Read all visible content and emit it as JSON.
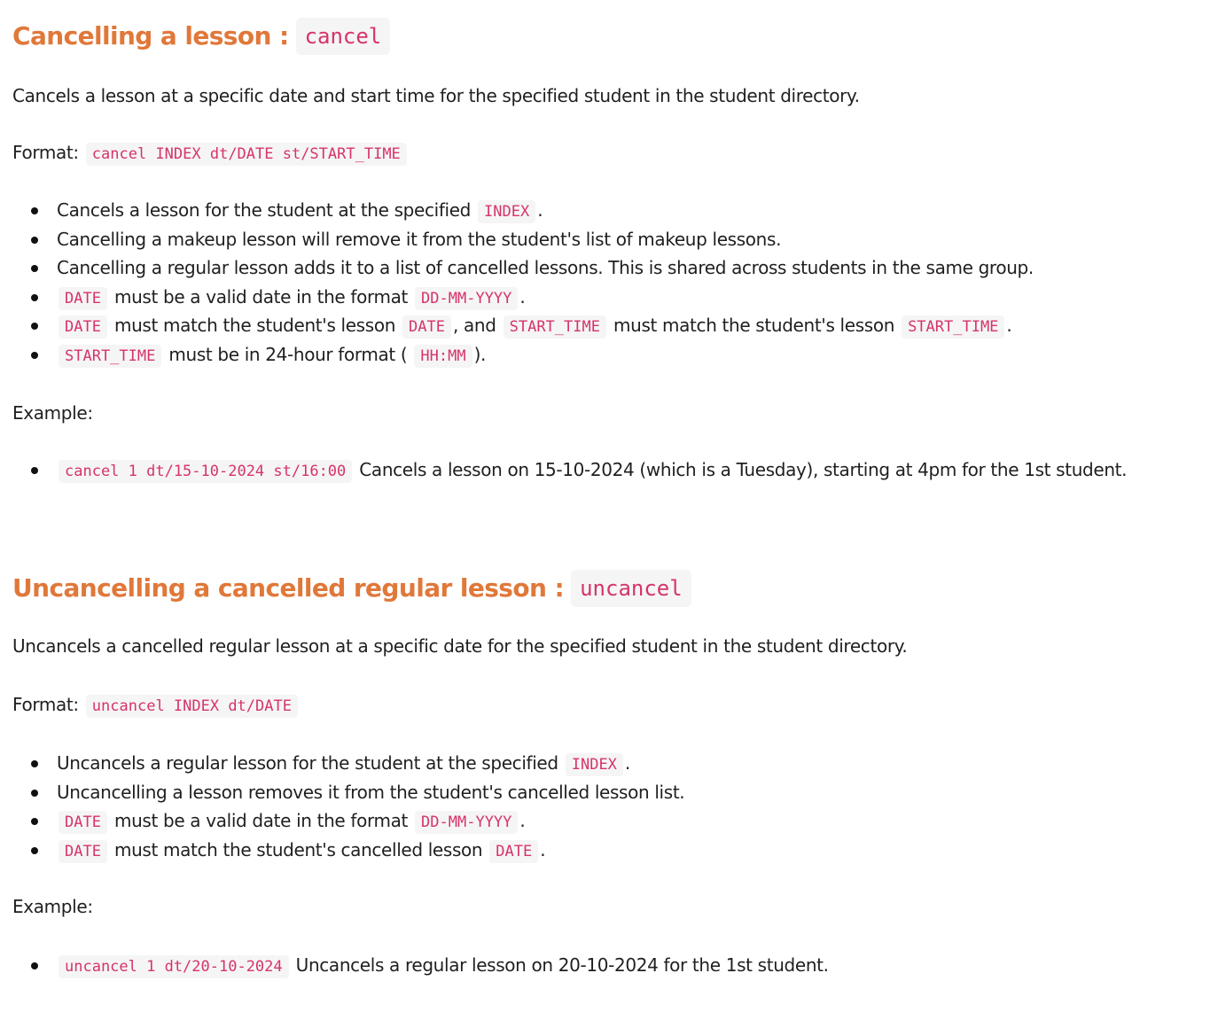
{
  "sections": [
    {
      "title": "Cancelling a lesson :",
      "command": "cancel",
      "description": "Cancels a lesson at a specific date and start time for the specified student in the student directory.",
      "format_label": "Format:",
      "format_code": "cancel INDEX dt/DATE st/START_TIME",
      "bullets": {
        "b1": {
          "t1": "Cancels a lesson for the student at the specified",
          "c1": "INDEX",
          "t2": "."
        },
        "b2": {
          "t1": "Cancelling a makeup lesson will remove it from the student's list of makeup lessons."
        },
        "b3": {
          "t1": "Cancelling a regular lesson adds it to a list of cancelled lessons. This is shared across students in the same group."
        },
        "b4": {
          "c1": "DATE",
          "t1": "must be a valid date in the format",
          "c2": "DD-MM-YYYY",
          "t2": "."
        },
        "b5": {
          "c1": "DATE",
          "t1": "must match the student's lesson",
          "c2": "DATE",
          "t2": ", and",
          "c3": "START_TIME",
          "t3": "must match the student's lesson",
          "c4": "START_TIME",
          "t4": "."
        },
        "b6": {
          "c1": "START_TIME",
          "t1": "must be in 24-hour format (",
          "c2": "HH:MM",
          "t2": ")."
        }
      },
      "example_label": "Example:",
      "example_code": "cancel 1 dt/15-10-2024 st/16:00",
      "example_text": "Cancels a lesson on 15-10-2024 (which is a Tuesday), starting at 4pm for the 1st student."
    },
    {
      "title": "Uncancelling a cancelled regular lesson :",
      "command": "uncancel",
      "description": "Uncancels a cancelled regular lesson at a specific date for the specified student in the student directory.",
      "format_label": "Format:",
      "format_code": "uncancel INDEX dt/DATE",
      "bullets": {
        "b1": {
          "t1": "Uncancels a regular lesson for the student at the specified",
          "c1": "INDEX",
          "t2": "."
        },
        "b2": {
          "t1": "Uncancelling a lesson removes it from the student's cancelled lesson list."
        },
        "b3": {
          "c1": "DATE",
          "t1": "must be a valid date in the format",
          "c2": "DD-MM-YYYY",
          "t2": "."
        },
        "b4": {
          "c1": "DATE",
          "t1": "must match the student's cancelled lesson",
          "c2": "DATE",
          "t2": "."
        }
      },
      "example_label": "Example:",
      "example_code": "uncancel 1 dt/20-10-2024",
      "example_text": "Uncancels a regular lesson on 20-10-2024 for the 1st student."
    }
  ],
  "colors": {
    "heading": "#e0783a",
    "code_text": "#d6336c",
    "code_background": "#f5f5f5",
    "body_text": "#1f1f1f"
  }
}
